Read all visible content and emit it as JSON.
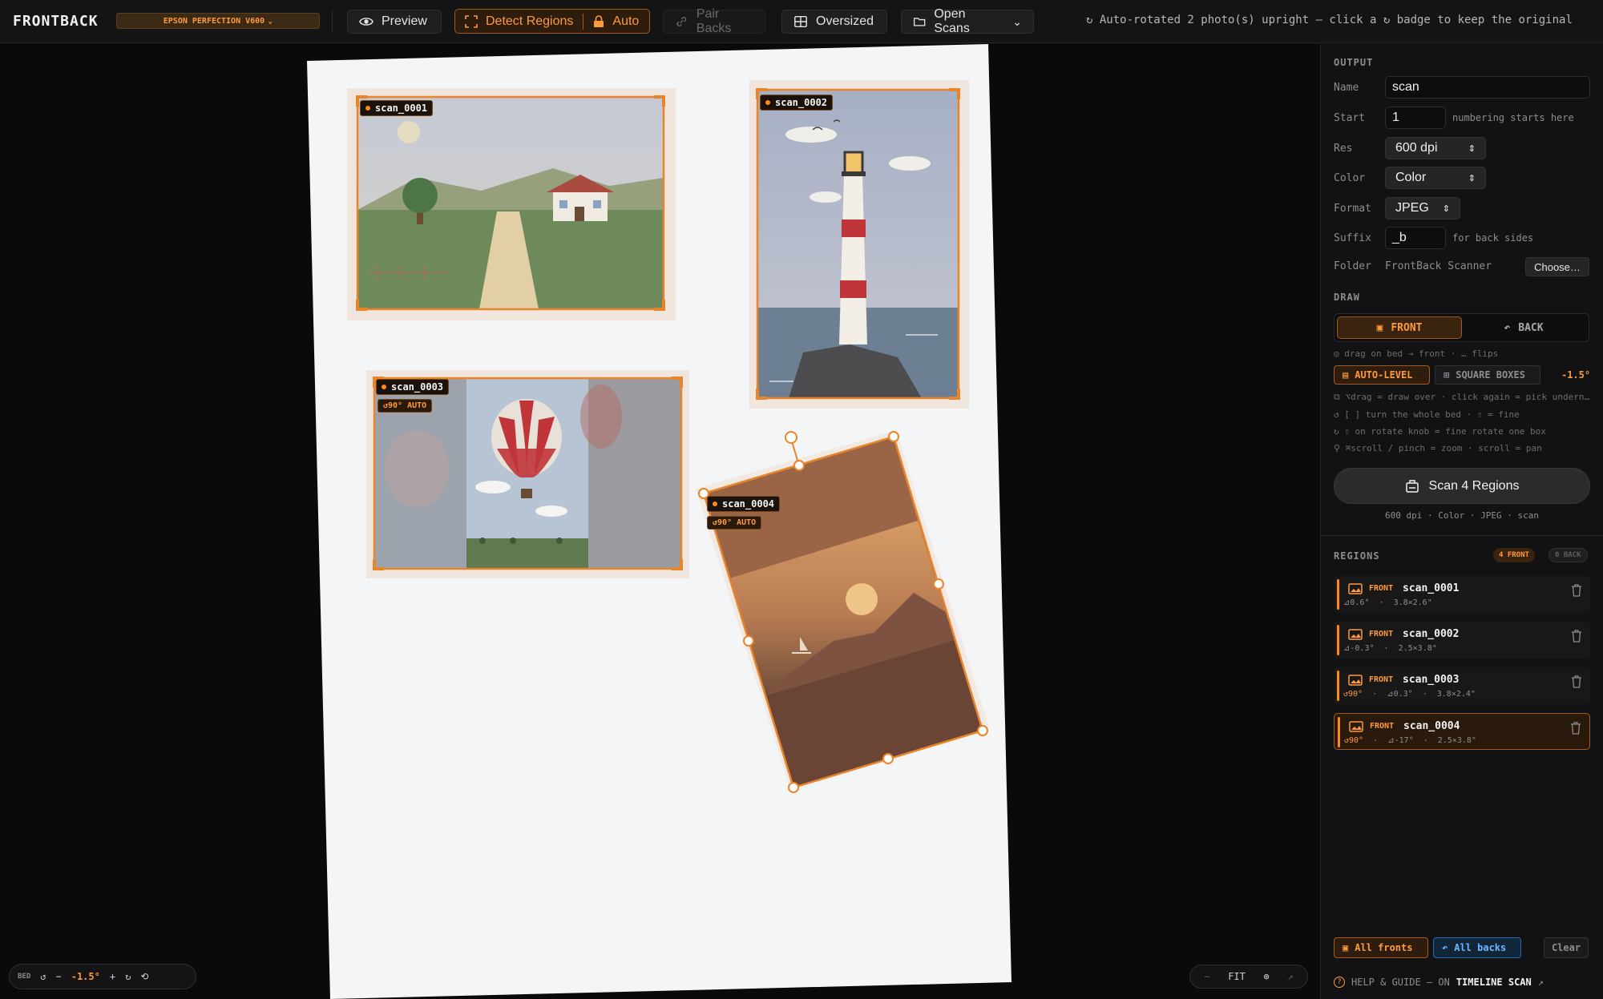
{
  "app": {
    "brand": "FRONTBACK",
    "device": "EPSON PERFECTION V600",
    "status": "↻ Auto-rotated 2 photo(s) upright — click a ↻ badge to keep the original"
  },
  "toolbar": {
    "preview": "Preview",
    "detect": "Detect Regions",
    "auto": "Auto",
    "pair": "Pair Backs",
    "oversized": "Oversized",
    "open": "Open Scans"
  },
  "regions_on_bed": [
    {
      "label": "scan_0001"
    },
    {
      "label": "scan_0002"
    },
    {
      "label": "scan_0003",
      "badge": "↺90° AUTO"
    },
    {
      "label": "scan_0004",
      "badge": "↺90° AUTO"
    }
  ],
  "bed_controls": {
    "label": "BED",
    "angle": "-1.5°"
  },
  "zoom_controls": {
    "fit": "FIT"
  },
  "panel": {
    "output_title": "OUTPUT",
    "name_label": "Name",
    "name_value": "scan",
    "start_label": "Start",
    "start_value": "1",
    "start_hint": "numbering starts here",
    "res_label": "Res",
    "res_value": "600 dpi",
    "color_label": "Color",
    "color_value": "Color",
    "format_label": "Format",
    "format_value": "JPEG",
    "suffix_label": "Suffix",
    "suffix_value": "_b",
    "suffix_hint": "for back sides",
    "folder_label": "Folder",
    "folder_value": "FrontBack Scanner",
    "choose": "Choose…",
    "draw_title": "DRAW",
    "front": "FRONT",
    "back": "BACK",
    "draw_note": "drag on bed → front · … flips",
    "autolevel": "AUTO-LEVEL",
    "squareboxes": "SQUARE BOXES",
    "level_deg": "-1.5°",
    "tips": [
      "⌥drag = draw over · click again = pick undern…",
      "[ ] turn the whole bed · ⇧ = fine",
      "⇧ on rotate knob = fine rotate one box",
      "⌘scroll / pinch = zoom · scroll = pan"
    ],
    "scan_button": "Scan 4 Regions",
    "scan_summary": "600 dpi · Color · JPEG · scan",
    "regions_title": "REGIONS",
    "tag_front": "4 FRONT",
    "tag_back": "0 BACK",
    "regions": [
      {
        "side": "FRONT",
        "name": "scan_0001",
        "rot": "",
        "meta": "⊿0.6°  ·  3.8×2.6\""
      },
      {
        "side": "FRONT",
        "name": "scan_0002",
        "rot": "",
        "meta": "⊿-0.3°  ·  2.5×3.8\""
      },
      {
        "side": "FRONT",
        "name": "scan_0003",
        "rot": "↺90°",
        "meta": "  ·  ⊿0.3°  ·  3.8×2.4\""
      },
      {
        "side": "FRONT",
        "name": "scan_0004",
        "rot": "↺90°",
        "meta": "  ·  ⊿-17°  ·  2.5×3.8\""
      }
    ],
    "all_fronts": "All fronts",
    "all_backs": "All backs",
    "clear": "Clear",
    "help_prefix": "HELP & GUIDE — ON",
    "help_link": "TIMELINE SCAN",
    "help_arrow": "↗"
  }
}
